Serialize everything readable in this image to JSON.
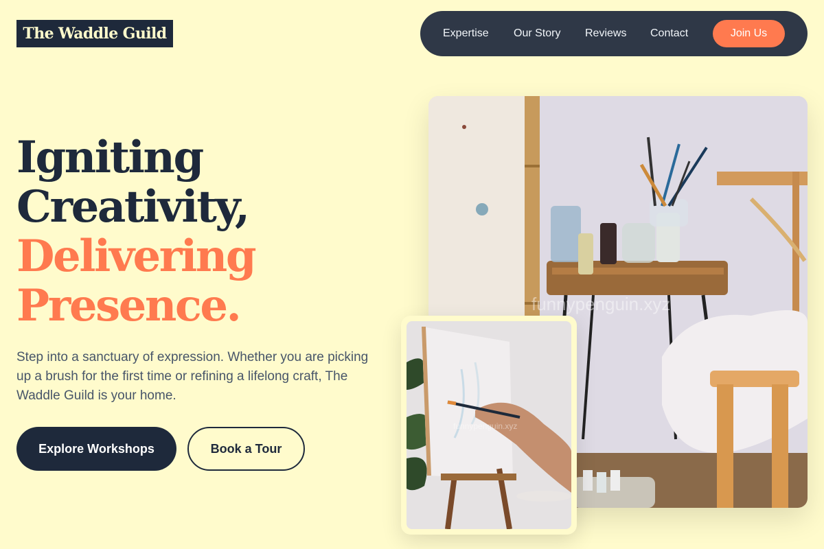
{
  "brand": {
    "logo_text": "The Waddle Guild"
  },
  "nav": {
    "items": [
      "Expertise",
      "Our Story",
      "Reviews",
      "Contact"
    ],
    "cta": "Join Us"
  },
  "hero": {
    "line1": "Igniting",
    "line2": "Creativity,",
    "line3": "Delivering",
    "line4": "Presence.",
    "description": "Step into a sanctuary of expression. Whether you are picking up a brush for the first time or refining a lifelong craft, The Waddle Guild is your home.",
    "primary_button": "Explore Workshops",
    "secondary_button": "Book a Tour"
  },
  "images": {
    "main_alt": "art-studio-table-photo",
    "inset_alt": "painting-on-easel-photo",
    "main_watermark": "funnypenguin.xyz",
    "inset_watermark": "funnypenguin.xyz"
  },
  "colors": {
    "background": "#fffbcc",
    "dark": "#1e293b",
    "accent": "#ff7a4f",
    "nav_bg": "#2f3847"
  }
}
